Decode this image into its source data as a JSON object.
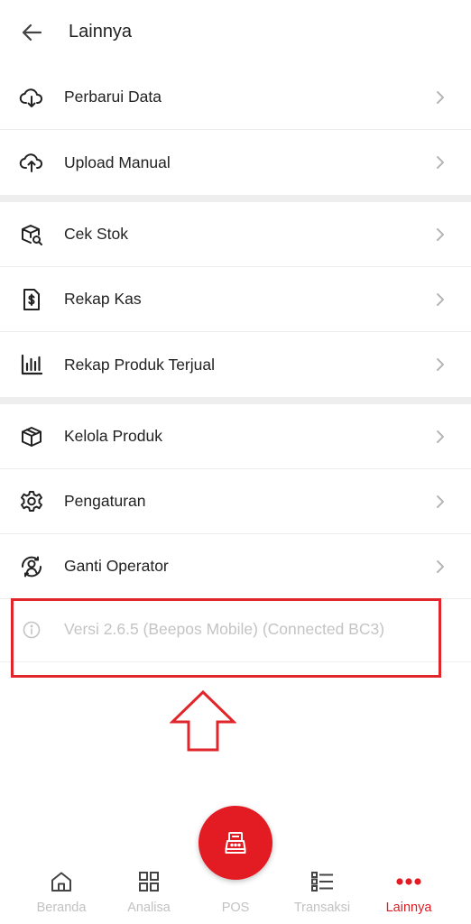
{
  "header": {
    "title": "Lainnya"
  },
  "menu": {
    "group1": [
      {
        "label": "Perbarui Data",
        "icon": "cloud-download-icon"
      },
      {
        "label": "Upload Manual",
        "icon": "cloud-upload-icon"
      }
    ],
    "group2": [
      {
        "label": "Cek Stok",
        "icon": "box-search-icon"
      },
      {
        "label": "Rekap Kas",
        "icon": "cash-document-icon"
      },
      {
        "label": "Rekap Produk Terjual",
        "icon": "bar-chart-icon"
      }
    ],
    "group3": [
      {
        "label": "Kelola Produk",
        "icon": "box-icon"
      },
      {
        "label": "Pengaturan",
        "icon": "gear-icon"
      },
      {
        "label": "Ganti Operator",
        "icon": "user-switch-icon"
      }
    ]
  },
  "version": {
    "label": "Versi 2.6.5 (Beepos Mobile) (Connected BC3)",
    "icon": "info-icon"
  },
  "annotation": {
    "highlight_color": "#e0252b"
  },
  "fab": {
    "icon": "cash-register-icon",
    "color": "#e31b23"
  },
  "bottom_nav": {
    "active_color": "#e31b23",
    "items": [
      {
        "label": "Beranda",
        "icon": "home-icon"
      },
      {
        "label": "Analisa",
        "icon": "grid-icon"
      },
      {
        "label": "POS",
        "icon": "cash-register-icon"
      },
      {
        "label": "Transaksi",
        "icon": "list-icon"
      },
      {
        "label": "Lainnya",
        "icon": "more-dots-icon"
      }
    ]
  }
}
